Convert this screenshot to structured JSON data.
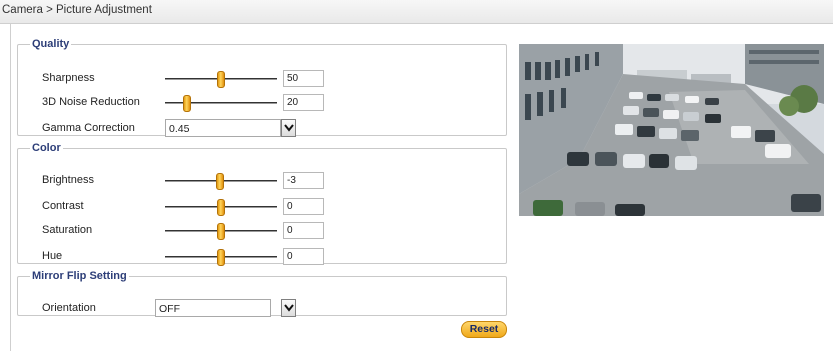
{
  "breadcrumb": "Camera > Picture Adjustment",
  "quality": {
    "legend": "Quality",
    "sharpness": {
      "label": "Sharpness",
      "value": "50",
      "level": 0.5
    },
    "noise": {
      "label": "3D Noise Reduction",
      "value": "20",
      "level": 0.2
    },
    "gamma": {
      "label": "Gamma Correction",
      "value": "0.45"
    }
  },
  "color": {
    "legend": "Color",
    "brightness": {
      "label": "Brightness",
      "value": "-3",
      "level": 0.49
    },
    "contrast": {
      "label": "Contrast",
      "value": "0",
      "level": 0.5
    },
    "saturation": {
      "label": "Saturation",
      "value": "0",
      "level": 0.5
    },
    "hue": {
      "label": "Hue",
      "value": "0",
      "level": 0.5
    }
  },
  "mirror": {
    "legend": "Mirror Flip Setting",
    "orientation": {
      "label": "Orientation",
      "value": "OFF"
    }
  },
  "reset_label": "Reset",
  "colors": {
    "accent": "#f0a81a",
    "legend": "#2d3e78"
  },
  "icons": {
    "dropdown": "chevron-down-icon",
    "slider_thumb": "slider-thumb"
  }
}
